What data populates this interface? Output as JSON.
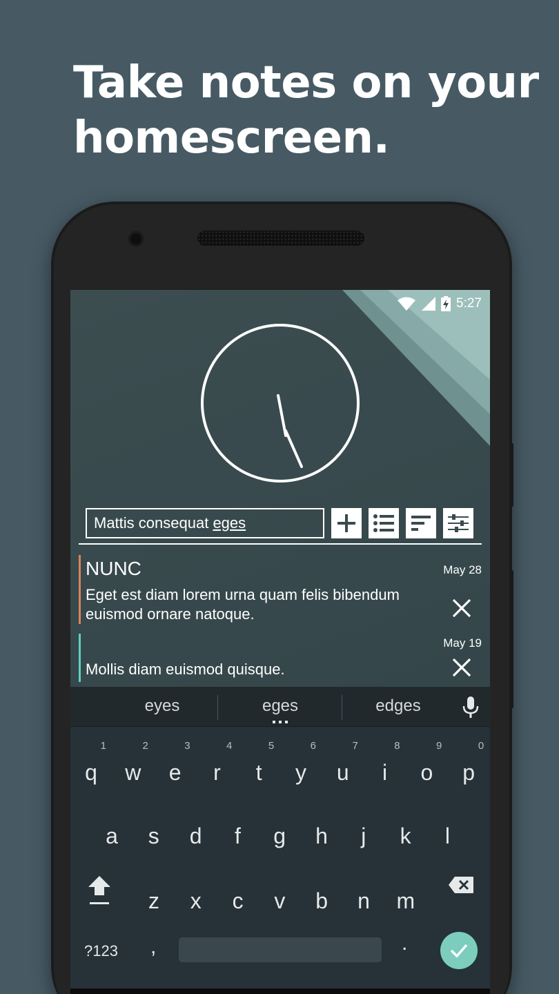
{
  "headline": {
    "line1": "Take notes on your",
    "line2": "homescreen."
  },
  "status_bar": {
    "time": "5:27",
    "icons": [
      "wifi-icon",
      "cell-signal-icon",
      "battery-charging-icon"
    ]
  },
  "widget": {
    "input": {
      "text_plain": "Mattis consequat ",
      "text_underlined": "eges"
    },
    "buttons": [
      "add-icon",
      "list-icon",
      "sort-icon",
      "settings-sliders-icon"
    ],
    "notes": [
      {
        "title": "NUNC",
        "body_line1": "Eget est diam lorem urna quam felis bibendum",
        "body_line2": "euismod ornare natoque.",
        "date": "May 28",
        "accent": "#d9825b"
      },
      {
        "title": "",
        "body_line1": "Mollis diam euismod quisque.",
        "body_line2": "",
        "date": "May 19",
        "accent": "#5fd0bf"
      }
    ]
  },
  "keyboard": {
    "suggestions": [
      "eyes",
      "eges",
      "edges"
    ],
    "row1": [
      {
        "k": "q",
        "n": "1"
      },
      {
        "k": "w",
        "n": "2"
      },
      {
        "k": "e",
        "n": "3"
      },
      {
        "k": "r",
        "n": "4"
      },
      {
        "k": "t",
        "n": "5"
      },
      {
        "k": "y",
        "n": "6"
      },
      {
        "k": "u",
        "n": "7"
      },
      {
        "k": "i",
        "n": "8"
      },
      {
        "k": "o",
        "n": "9"
      },
      {
        "k": "p",
        "n": "0"
      }
    ],
    "row2": [
      "a",
      "s",
      "d",
      "f",
      "g",
      "h",
      "j",
      "k",
      "l"
    ],
    "row3": [
      "z",
      "x",
      "c",
      "v",
      "b",
      "n",
      "m"
    ],
    "symbols_label": "?123",
    "comma": ",",
    "period": ".",
    "colors": {
      "background": "#263238",
      "enter": "#7ccdbd"
    }
  }
}
